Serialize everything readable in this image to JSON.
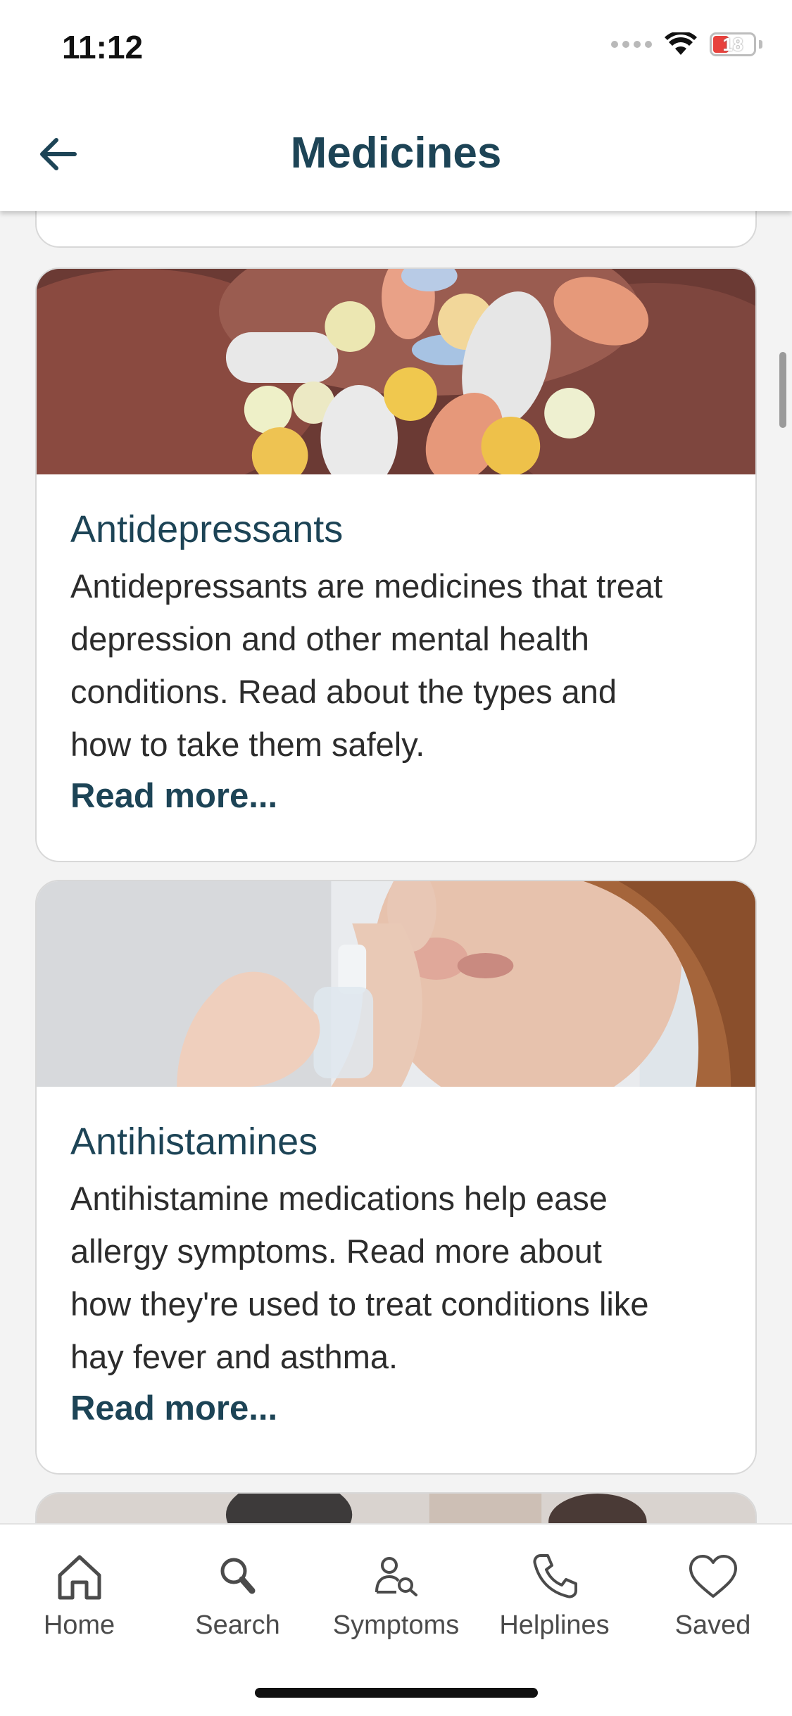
{
  "status_bar": {
    "time": "11:12",
    "battery": "18"
  },
  "header": {
    "title": "Medicines"
  },
  "cards": [
    {
      "title": "Antidepressants",
      "description_lines": [
        "Antidepressants are medicines that treat",
        "depression and other mental health",
        "conditions. Read about the types and",
        "how to take them safely."
      ],
      "read_more": "Read more..."
    },
    {
      "title": "Antihistamines",
      "description_lines": [
        "Antihistamine medications help ease",
        "allergy symptoms. Read more about",
        "how they're used to treat conditions like",
        "hay fever and asthma."
      ],
      "read_more": "Read more..."
    }
  ],
  "tab_bar": {
    "items": [
      {
        "label": "Home",
        "icon": "home-icon"
      },
      {
        "label": "Search",
        "icon": "search-icon"
      },
      {
        "label": "Symptoms",
        "icon": "symptoms-icon"
      },
      {
        "label": "Helplines",
        "icon": "phone-icon"
      },
      {
        "label": "Saved",
        "icon": "heart-icon"
      }
    ]
  },
  "colors": {
    "accent": "#1d4456",
    "background": "#f3f3f3",
    "card": "#ffffff"
  }
}
